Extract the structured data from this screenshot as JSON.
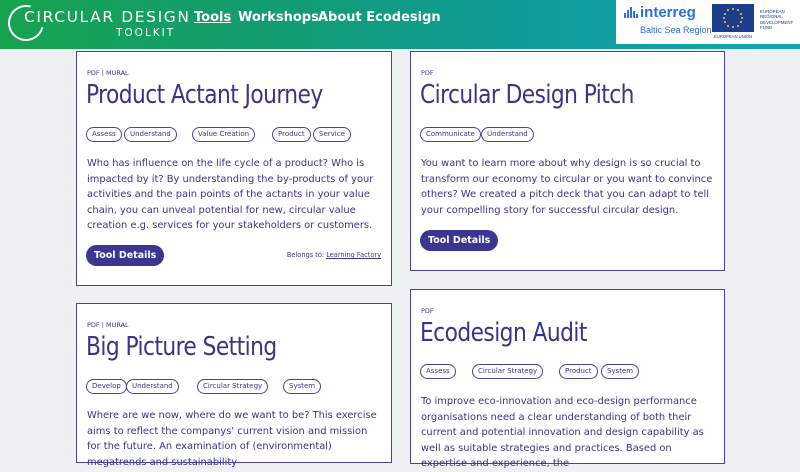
{
  "header": {
    "logo_title": "CIRCULAR DESIGN",
    "logo_subtitle": "TOOLKIT",
    "nav": [
      "Tools",
      "Workshops",
      "About Ecodesign"
    ],
    "active_nav": "Tools",
    "gradient_colors": [
      "#16a34f",
      "#11a7b2"
    ]
  },
  "partner": {
    "name": "interreg",
    "region": "Baltic Sea Region",
    "eu_fund": "EUROPEAN REGIONAL DEVELOPMENT FUND",
    "eu_union": "EUROPEAN UNION"
  },
  "accent_color": "#3d3592",
  "cards": [
    {
      "format": "PDF | MURAL",
      "title": "Product Actant Journey",
      "tags": [
        "Assess",
        "Understand",
        "Value Creation",
        "Product",
        "Service"
      ],
      "description": "Who has influence on the life cycle of a product? Who is impacted by it? By understanding the by-products of your activities and the pain points of the actants in your value chain, you can unveal potential for new, circular value creation e.g. services for your stakeholders or customers.",
      "button": "Tool Details",
      "belongs_label": "Belongs to:",
      "belongs_link": "Learning Factory"
    },
    {
      "format": "PDF",
      "title": "Circular Design Pitch",
      "tags": [
        "Communicate",
        "Understand"
      ],
      "description": "You want to learn more about why design is so crucial to transform our economy to circular or you want to convince others? We created a pitch deck that you can adapt to tell your compelling story for successful circular design.",
      "button": "Tool Details"
    },
    {
      "format": "PDF | MURAL",
      "title": "Big Picture Setting",
      "tags": [
        "Develop",
        "Understand",
        "Circular Strategy",
        "System"
      ],
      "description": "Where are we now, where do we want to be? This exercise aims to reflect the companys' current vision and mission for the future. An examination of (environmental) megatrends and sustainability"
    },
    {
      "format": "PDF",
      "title": "Ecodesign Audit",
      "tags": [
        "Assess",
        "Circular Strategy",
        "Product",
        "System"
      ],
      "description": "To improve eco-innovation and eco-design performance organisations need a clear understanding of both their current and potential innovation and design capability as well as suitable strategies and practices. Based on expertise and experience, the"
    }
  ]
}
